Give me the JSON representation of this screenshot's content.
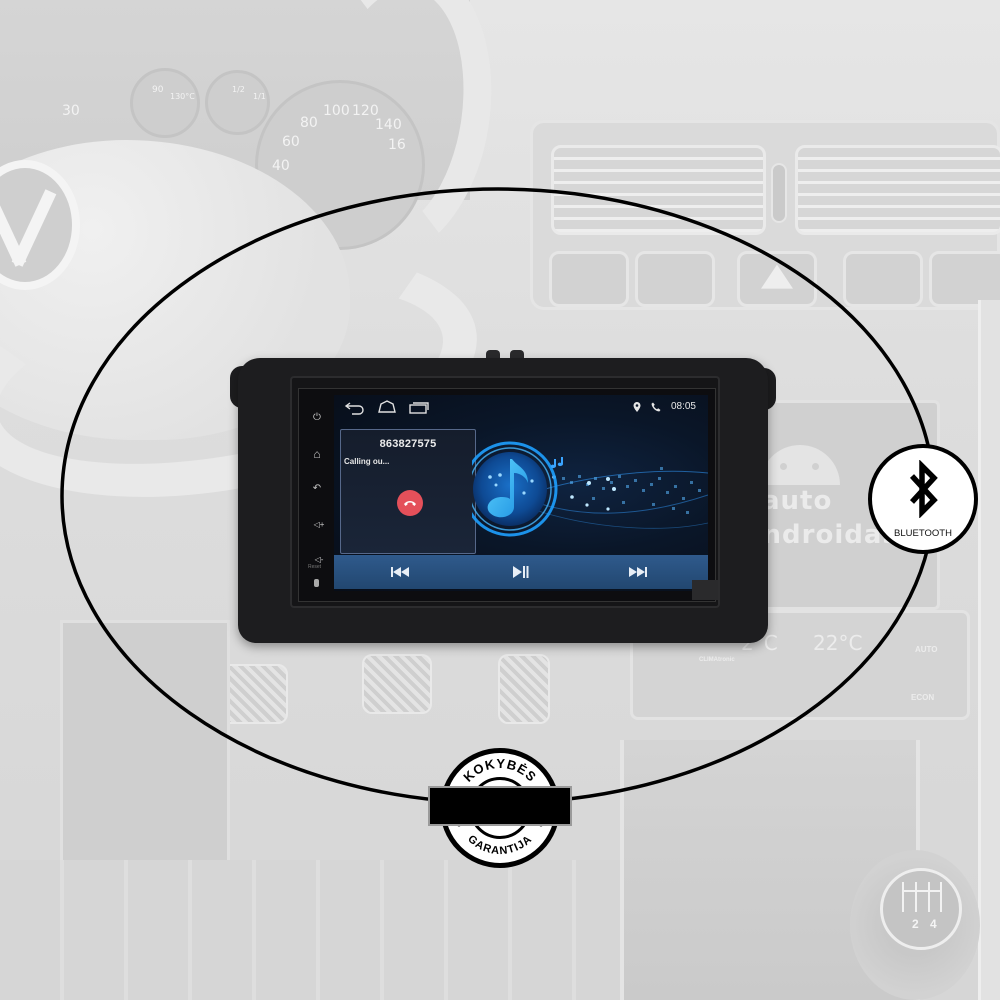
{
  "background": {
    "dashboard_gauges": {
      "speed_ticks": [
        "30",
        "40",
        "60",
        "80",
        "100",
        "120",
        "140",
        "16"
      ],
      "temp_gauge": [
        "90",
        "130°C"
      ],
      "fuel_gauge": [
        "1/2",
        "1/1"
      ]
    },
    "brand_logo": {
      "line1": "auto",
      "line2": "androidas"
    },
    "climate_panel": {
      "left_temp": "2°C",
      "right_temp": "22°C",
      "auto_label": "AUTO",
      "econ_label": "ECON",
      "brand": "CLIMAtronic"
    },
    "gear_knob": {
      "labels": "2 4"
    }
  },
  "head_unit": {
    "side_keys": [
      {
        "icon": "power-icon",
        "glyph": "⏻"
      },
      {
        "icon": "home-icon",
        "glyph": "⌂"
      },
      {
        "icon": "back-icon",
        "glyph": "↶"
      },
      {
        "icon": "volume-up-icon",
        "glyph": "◁+"
      },
      {
        "icon": "volume-down-icon",
        "glyph": "◁-"
      }
    ],
    "reset_label": "Reset",
    "statusbar": {
      "nav_buttons": [
        "back",
        "home",
        "recents"
      ],
      "status_icons": [
        "location-icon",
        "phone-icon"
      ],
      "time": "08:05"
    },
    "call": {
      "number": "863827575",
      "status": "Calling ou...",
      "hangup_color": "#e4505a"
    },
    "media_controls": {
      "prev": "previous-track",
      "play_pause": "play-pause",
      "next": "next-track"
    },
    "accent_color": "#1e90ff",
    "media_bar_color": "#2a5282"
  },
  "badges": {
    "bluetooth": {
      "label": "BLUETOOTH"
    },
    "quality": {
      "top_text": "KOKYBĖS",
      "bottom_text": "GARANTIJA"
    }
  }
}
